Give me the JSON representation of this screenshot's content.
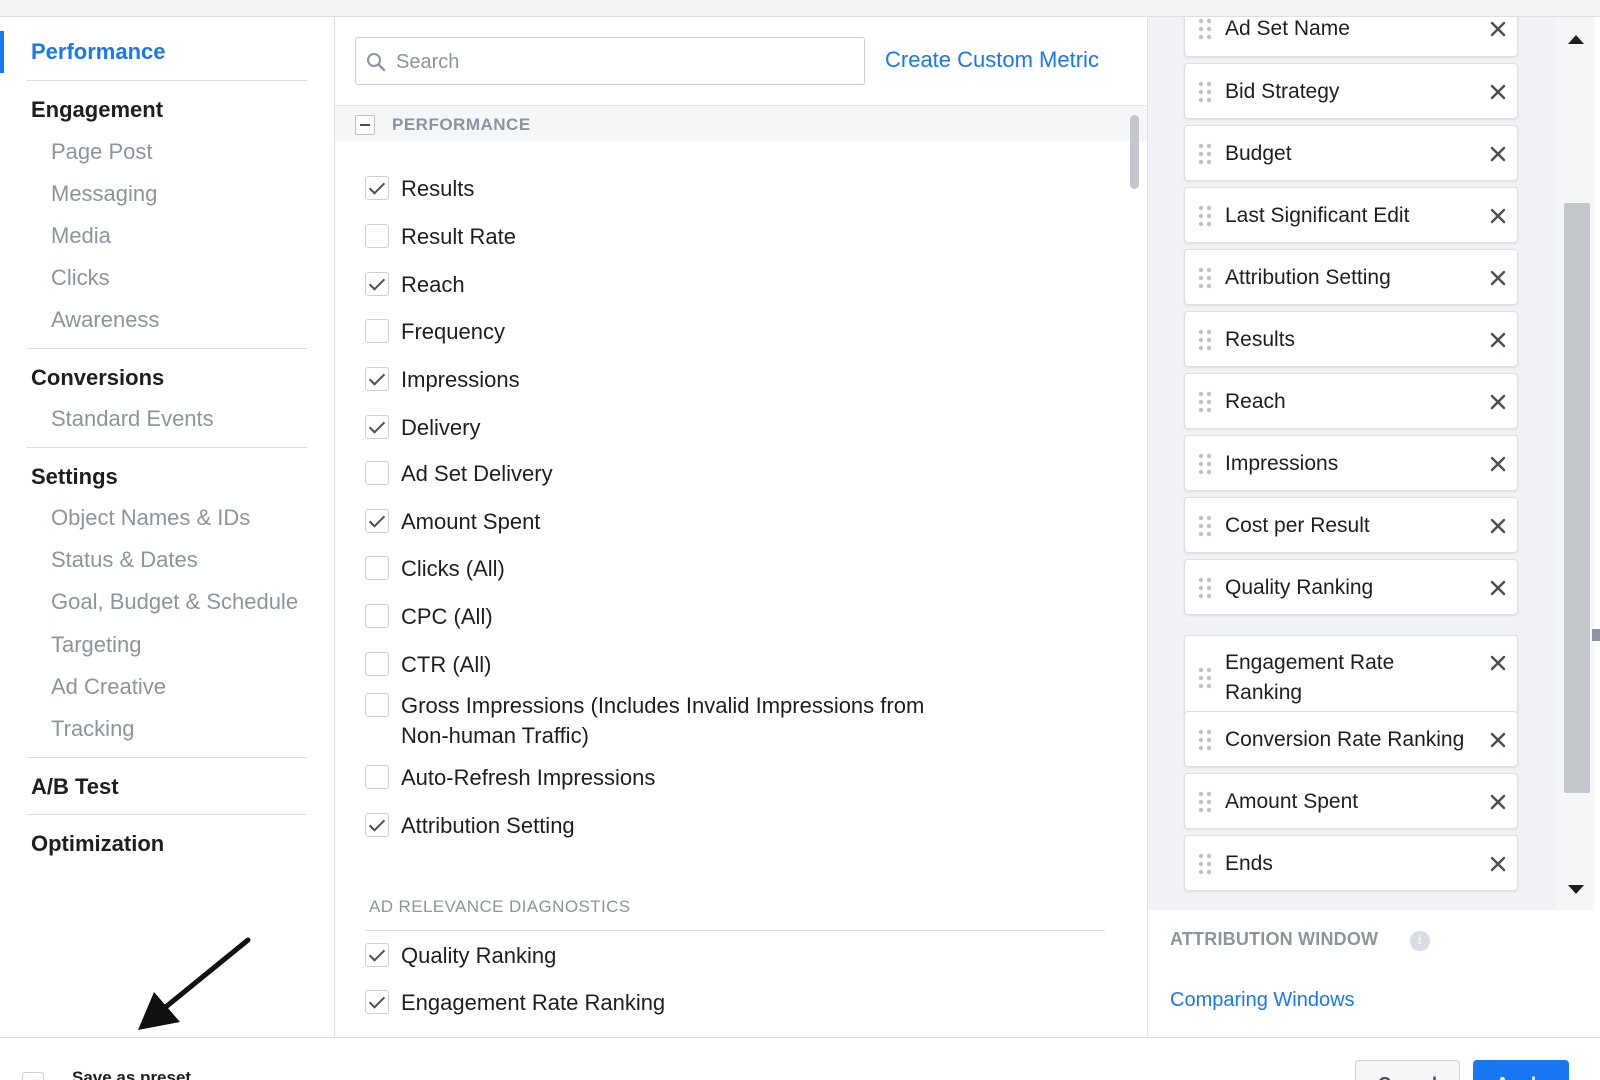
{
  "nav": {
    "performance": "Performance",
    "engagement": "Engagement",
    "engagement_items": [
      "Page Post",
      "Messaging",
      "Media",
      "Clicks",
      "Awareness"
    ],
    "conversions": "Conversions",
    "conversions_items": [
      "Standard Events"
    ],
    "settings": "Settings",
    "settings_items": [
      "Object Names & IDs",
      "Status & Dates",
      "Goal, Budget & Schedule",
      "Targeting",
      "Ad Creative",
      "Tracking"
    ],
    "ab_test": "A/B Test",
    "optimization": "Optimization"
  },
  "search": {
    "placeholder": "Search",
    "value": ""
  },
  "create_custom_metric": "Create Custom Metric",
  "performance_header": "PERFORMANCE",
  "metrics": [
    {
      "label": "Results",
      "checked": true
    },
    {
      "label": "Result Rate",
      "checked": false
    },
    {
      "label": "Reach",
      "checked": true
    },
    {
      "label": "Frequency",
      "checked": false
    },
    {
      "label": "Impressions",
      "checked": true
    },
    {
      "label": "Delivery",
      "checked": true
    },
    {
      "label": "Ad Set Delivery",
      "checked": false
    },
    {
      "label": "Amount Spent",
      "checked": true
    },
    {
      "label": "Clicks (All)",
      "checked": false
    },
    {
      "label": "CPC (All)",
      "checked": false
    },
    {
      "label": "CTR (All)",
      "checked": false
    },
    {
      "label": "Gross Impressions (Includes Invalid Impressions from Non-human Traffic)",
      "checked": false
    },
    {
      "label": "Auto-Refresh Impressions",
      "checked": false
    },
    {
      "label": "Attribution Setting",
      "checked": true
    }
  ],
  "diagnostics_header": "AD RELEVANCE DIAGNOSTICS",
  "diagnostics_metrics": [
    {
      "label": "Quality Ranking",
      "checked": true
    },
    {
      "label": "Engagement Rate Ranking",
      "checked": true
    }
  ],
  "selected_columns": [
    "Ad Set Name",
    "Bid Strategy",
    "Budget",
    "Last Significant Edit",
    "Attribution Setting",
    "Results",
    "Reach",
    "Impressions",
    "Cost per Result",
    "Quality Ranking",
    "Engagement Rate Ranking",
    "Conversion Rate Ranking",
    "Amount Spent",
    "Ends"
  ],
  "attribution_window_label": "ATTRIBUTION WINDOW",
  "comparing_windows": "Comparing Windows",
  "footer": {
    "save_as_preset": "Save as preset",
    "cancel": "Cancel",
    "apply": "Apply"
  },
  "colors": {
    "accent": "#1877f2",
    "muted": "#8d949e",
    "panel_bg": "#f0f2f5"
  }
}
